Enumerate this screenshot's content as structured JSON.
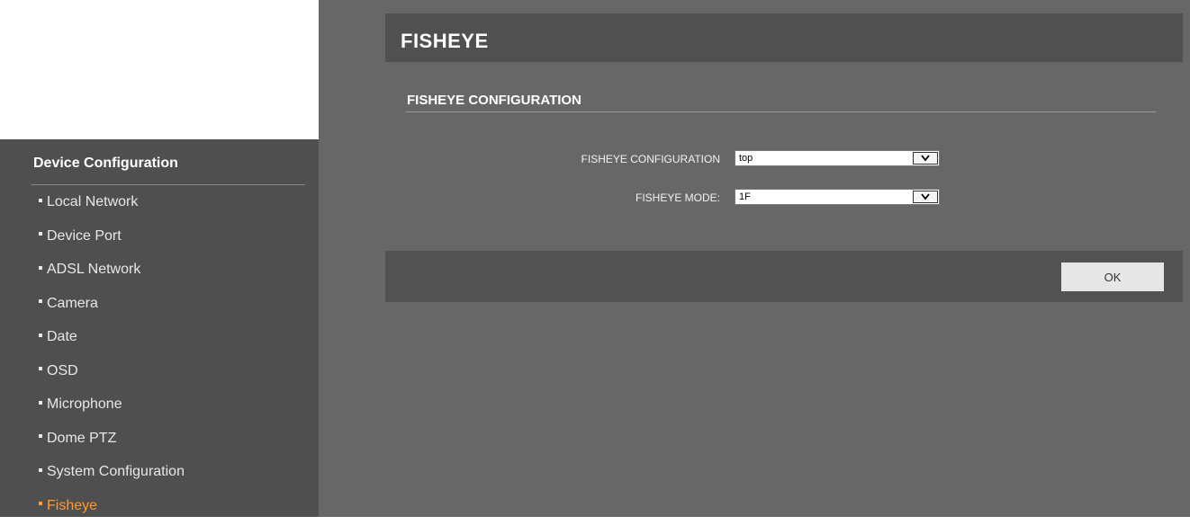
{
  "sidebar": {
    "header": "Device Configuration",
    "items": [
      {
        "label": "Local Network"
      },
      {
        "label": "Device Port"
      },
      {
        "label": "ADSL Network"
      },
      {
        "label": "Camera"
      },
      {
        "label": "Date"
      },
      {
        "label": "OSD"
      },
      {
        "label": "Microphone"
      },
      {
        "label": "Dome PTZ"
      },
      {
        "label": "System Configuration"
      },
      {
        "label": "Fisheye"
      }
    ],
    "active_item": "Fisheye"
  },
  "main": {
    "title": "FISHEYE",
    "section_title": "FISHEYE CONFIGURATION",
    "fields": [
      {
        "label": "FISHEYE CONFIGURATION",
        "value": "top"
      },
      {
        "label": "FISHEYE MODE:",
        "value": "1F"
      }
    ],
    "ok_label": "OK"
  },
  "colors": {
    "sidebar_bg": "#4f4f4f",
    "main_bg": "#676767",
    "bar_bg": "#505050",
    "active_accent": "#ff9a2e"
  },
  "icons": {
    "bullet": "bullet-icon",
    "dropdown": "chevron-down-icon"
  }
}
